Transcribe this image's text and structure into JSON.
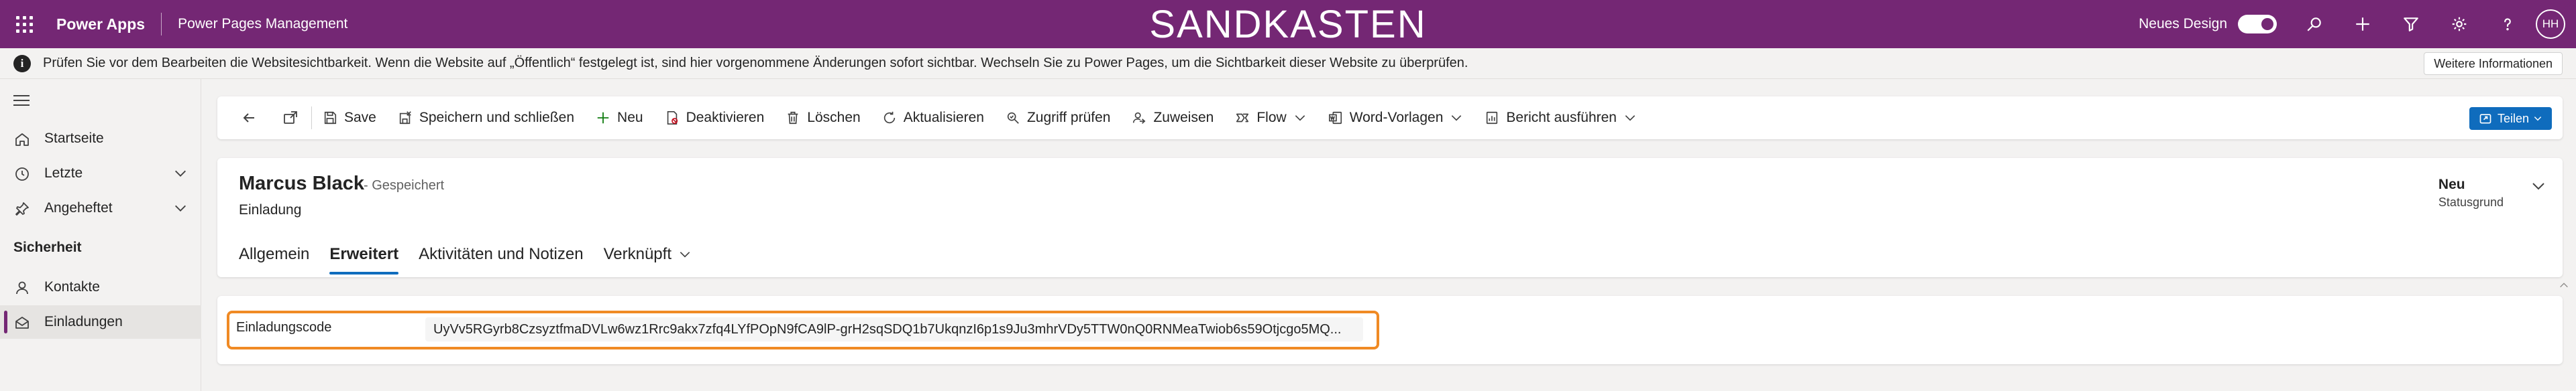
{
  "topbar": {
    "app_name": "Power Apps",
    "sub_app": "Power Pages Management",
    "environment": "SANDKASTEN",
    "new_design_label": "Neues Design",
    "new_design_enabled": true,
    "icons": [
      "search-icon",
      "add-icon",
      "filter-icon",
      "gear-icon",
      "help-icon"
    ],
    "avatar_initials": "HH",
    "color": "#742774"
  },
  "infobar": {
    "text": "Prüfen Sie vor dem Bearbeiten die Websitesichtbarkeit. Wenn die Website auf „Öffentlich“ festgelegt ist, sind hier vorgenommene Änderungen sofort sichtbar. Wechseln Sie zu Power Pages, um die Sichtbarkeit dieser Website zu überprüfen.",
    "more_info": "Weitere Informationen"
  },
  "sidebar": {
    "items": [
      {
        "label": "Startseite",
        "icon": "home-icon"
      },
      {
        "label": "Letzte",
        "icon": "clock-icon"
      },
      {
        "label": "Angeheftet",
        "icon": "pin-icon"
      }
    ],
    "section_title": "Sicherheit",
    "section_items": [
      {
        "label": "Kontakte",
        "icon": "person-icon"
      },
      {
        "label": "Einladungen",
        "icon": "mail-icon",
        "active": true
      }
    ]
  },
  "commandbar": {
    "save": "Save",
    "save_close": "Speichern und schließen",
    "new": "Neu",
    "deactivate": "Deaktivieren",
    "delete": "Löschen",
    "refresh": "Aktualisieren",
    "check_access": "Zugriff prüfen",
    "assign": "Zuweisen",
    "flow": "Flow",
    "word_templates": "Word-Vorlagen",
    "run_report": "Bericht ausführen",
    "share": "Teilen"
  },
  "record": {
    "name": "Marcus Black",
    "saved_status": "- Gespeichert",
    "entity": "Einladung",
    "status_value": "Neu",
    "status_label": "Statusgrund",
    "tabs": [
      {
        "label": "Allgemein",
        "active": false
      },
      {
        "label": "Erweitert",
        "active": true
      },
      {
        "label": "Aktivitäten und Notizen",
        "active": false
      },
      {
        "label": "Verknüpft",
        "active": false,
        "dropdown": true
      }
    ]
  },
  "form": {
    "field_label": "Einladungscode",
    "field_value": "UyVv5RGyrb8CzsyztfmaDVLw6wz1Rrc9akx7zfq4LYfPOpN9fCA9lP-grH2sqSDQ1b7UkqnzI6p1s9Ju3mhrVDy5TTW0nQ0RNMeaTwiob6s59Otjcgo5MQ..."
  },
  "colors": {
    "accent": "#742774",
    "primary_button": "#0f6cbd",
    "highlight": "#f08a24"
  }
}
